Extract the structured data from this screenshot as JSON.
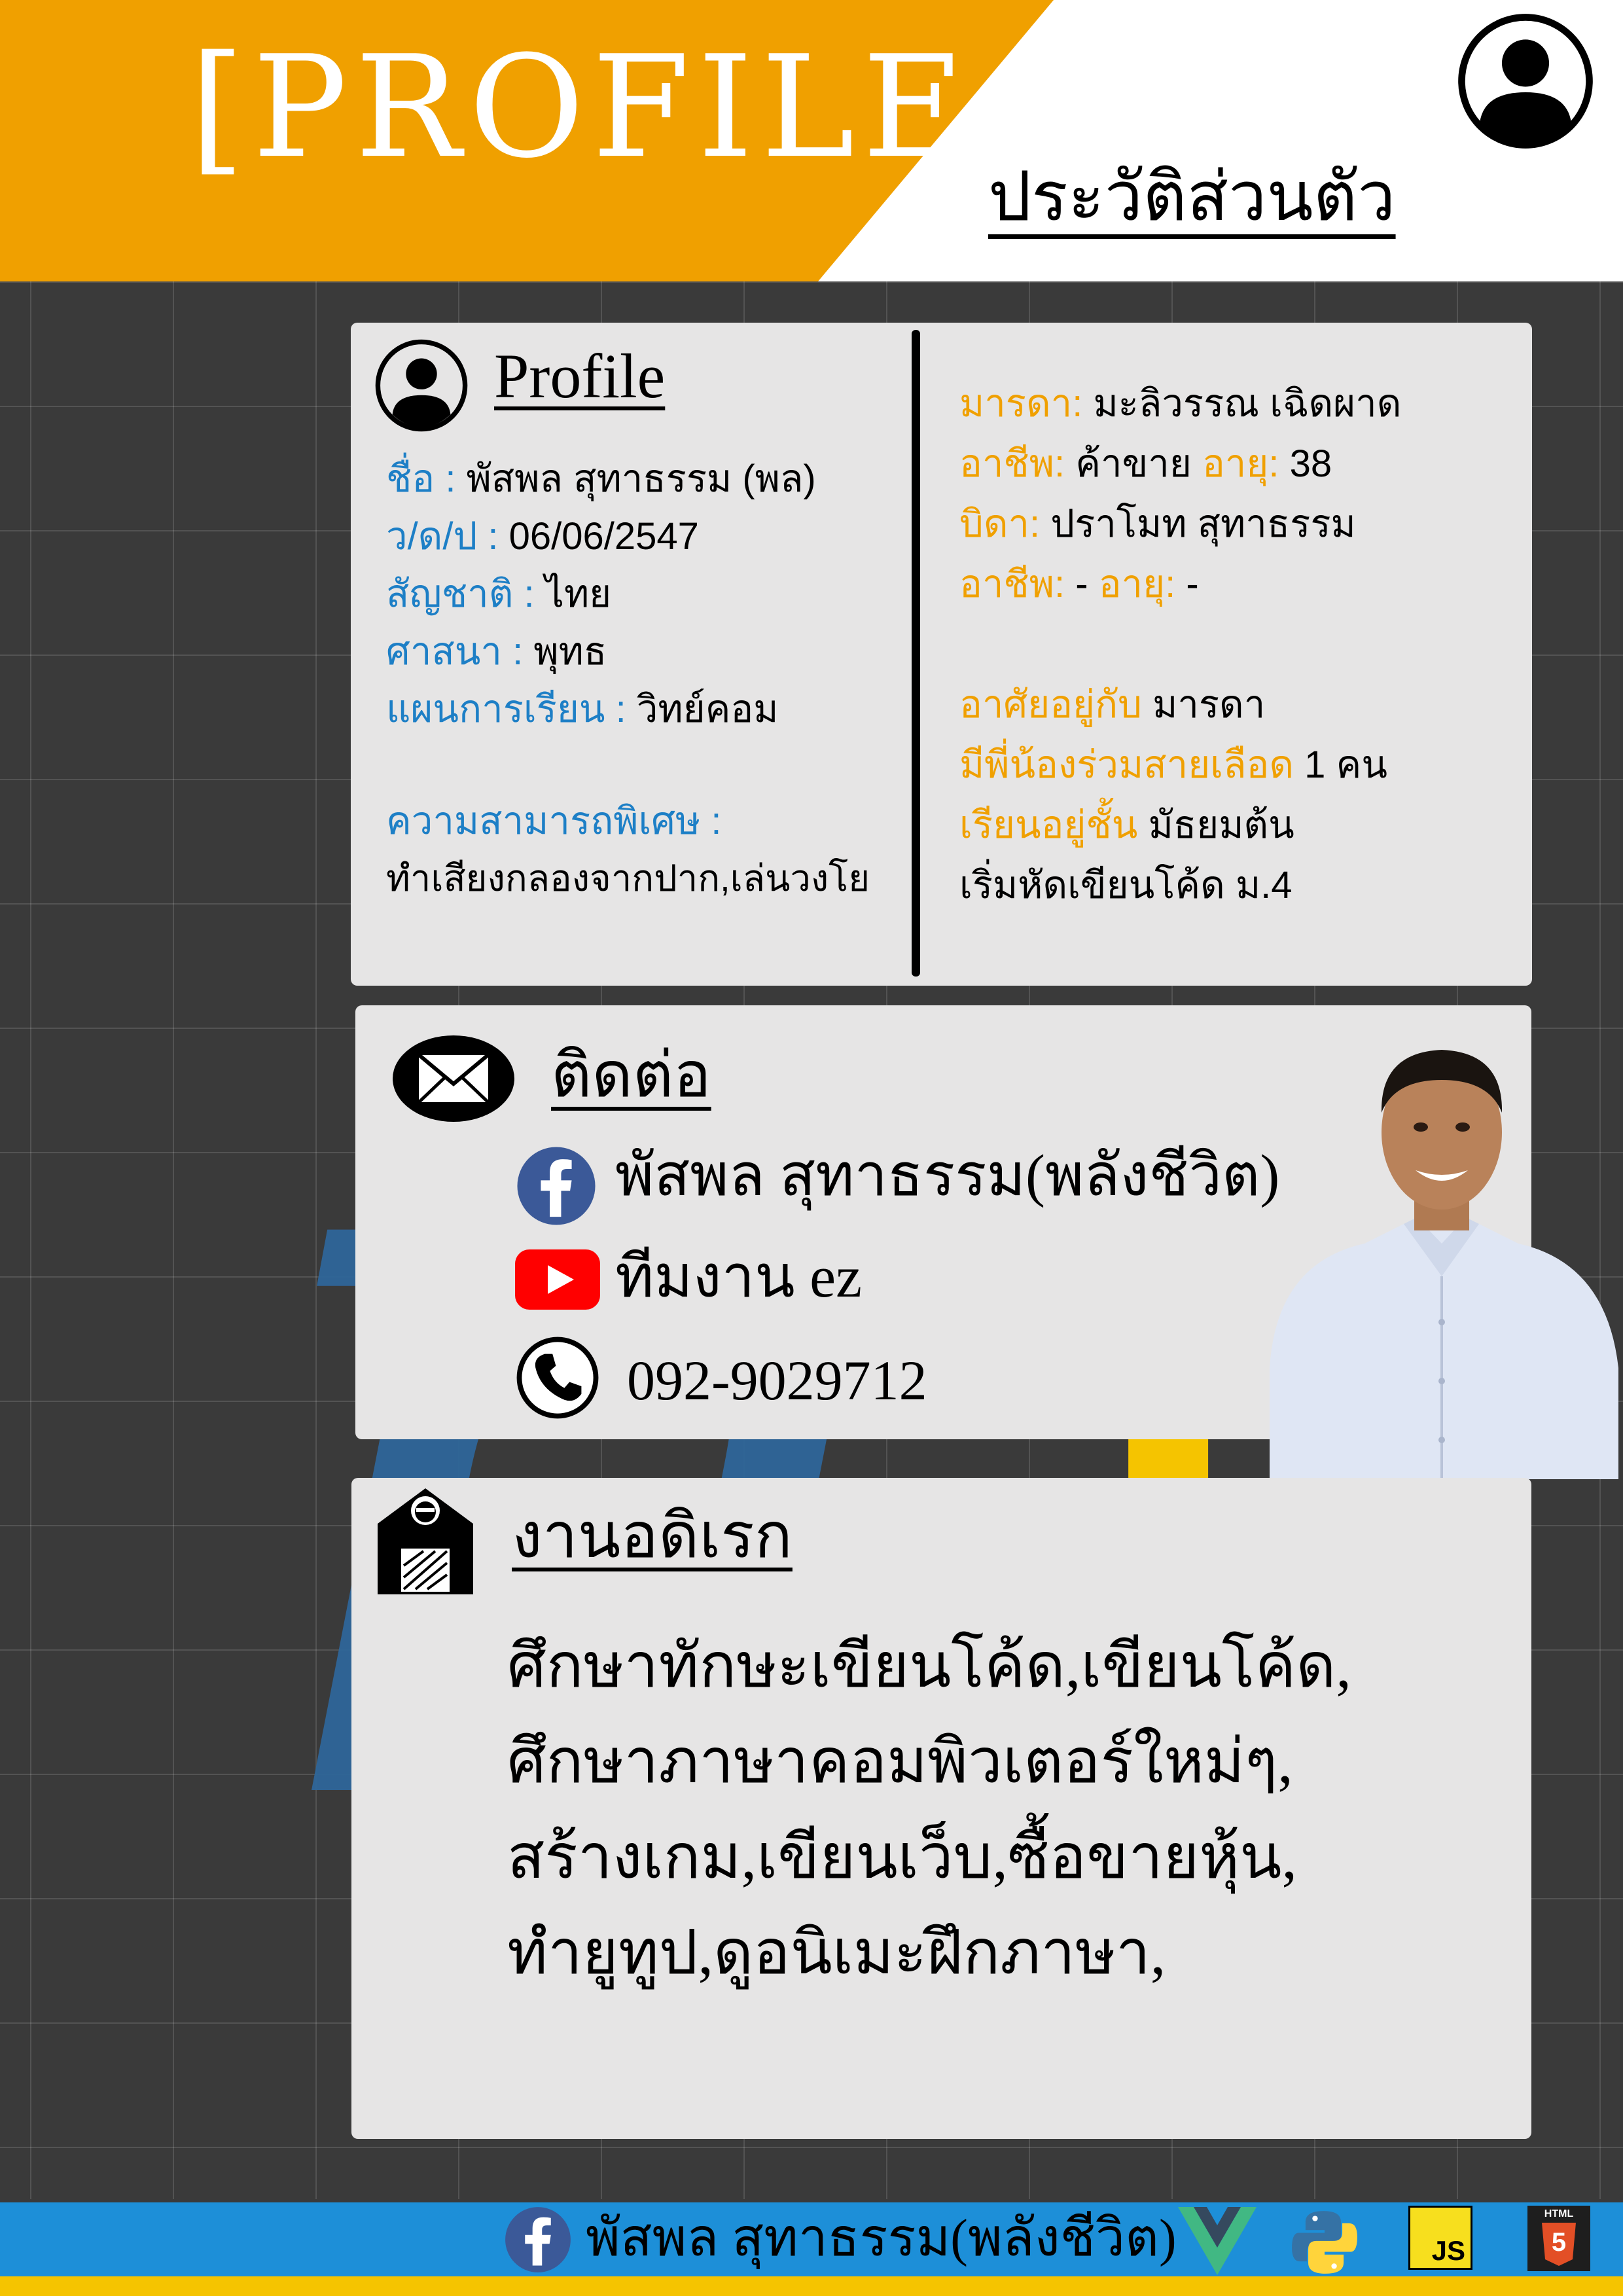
{
  "header": {
    "title": "[PROFILE",
    "subtitle": "ประวัติส่วนตัว"
  },
  "profile": {
    "heading": "Profile",
    "name_label": "ชื่อ :",
    "name_value": "พัสพล สุทาธรรม (พล)",
    "dob_label": "ว/ด/ป :",
    "dob_value": "06/06/2547",
    "nationality_label": "สัญชาติ :",
    "nationality_value": "ไทย",
    "religion_label": "ศาสนา :",
    "religion_value": "พุทธ",
    "program_label": "แผนการเรียน :",
    "program_value": "วิทย์คอม",
    "talent_label": "ความสามารถพิเศษ :",
    "talent_value": "ทำเสียงกลองจากปาก,เล่นวงโย"
  },
  "family": {
    "mother_label": "มารดา:",
    "mother_value": "มะลิวรรณ เฉิดผาด",
    "mother_job_label": "อาชีพ:",
    "mother_job_value": "ค้าขาย",
    "mother_age_label": "อายุ:",
    "mother_age_value": "38",
    "father_label": "บิดา:",
    "father_value": "ปราโมท สุทาธรรม",
    "father_job_label": "อาชีพ:",
    "father_job_value": "-",
    "father_age_label": "อายุ:",
    "father_age_value": "-",
    "lives_with_label": "อาศัยอยู่กับ",
    "lives_with_value": "มารดา",
    "siblings_label": "มีพี่น้องร่วมสายเลือด",
    "siblings_value": "1 คน",
    "grade_label": "เรียนอยู่ชั้น",
    "grade_value": "มัธยมต้น",
    "coding_start": "เริ่มหัดเขียนโค้ด ม.4"
  },
  "contact": {
    "heading": "ติดต่อ",
    "facebook": "พัสพล สุทาธรรม(พลังชีวิต)",
    "youtube": "ทีมงาน ez",
    "phone": "092-9029712"
  },
  "hobbies": {
    "heading": "งานอดิเรก",
    "lines": [
      "ศึกษาทักษะเขียนโค้ด,เขียนโค้ด,",
      "ศึกษาภาษาคอมพิวเตอร์ใหม่ๆ,",
      "สร้างเกม,เขียนเว็บ,ซื้อขายหุ้น,",
      "ทำยูทูป,ดูอนิเมะฝึกภาษา,"
    ]
  },
  "footer": {
    "facebook": "พัสพล สุทาธรรม(พลังชีวิต)",
    "js_label": "JS",
    "html_label": "HTML",
    "html_num": "5"
  },
  "icons": [
    "user-icon",
    "mail-icon",
    "facebook-icon",
    "youtube-icon",
    "phone-icon",
    "work-icon",
    "vue-icon",
    "python-icon",
    "js-icon",
    "html5-icon"
  ],
  "colors": {
    "header_orange": "#f0a000",
    "label_blue": "#1d7fc6",
    "label_orange": "#f0a000",
    "card_bg": "#e6e5e5",
    "background": "#3a3a3a",
    "footer_blue": "#1d8fd8",
    "footer_yellow": "#f5c400"
  }
}
